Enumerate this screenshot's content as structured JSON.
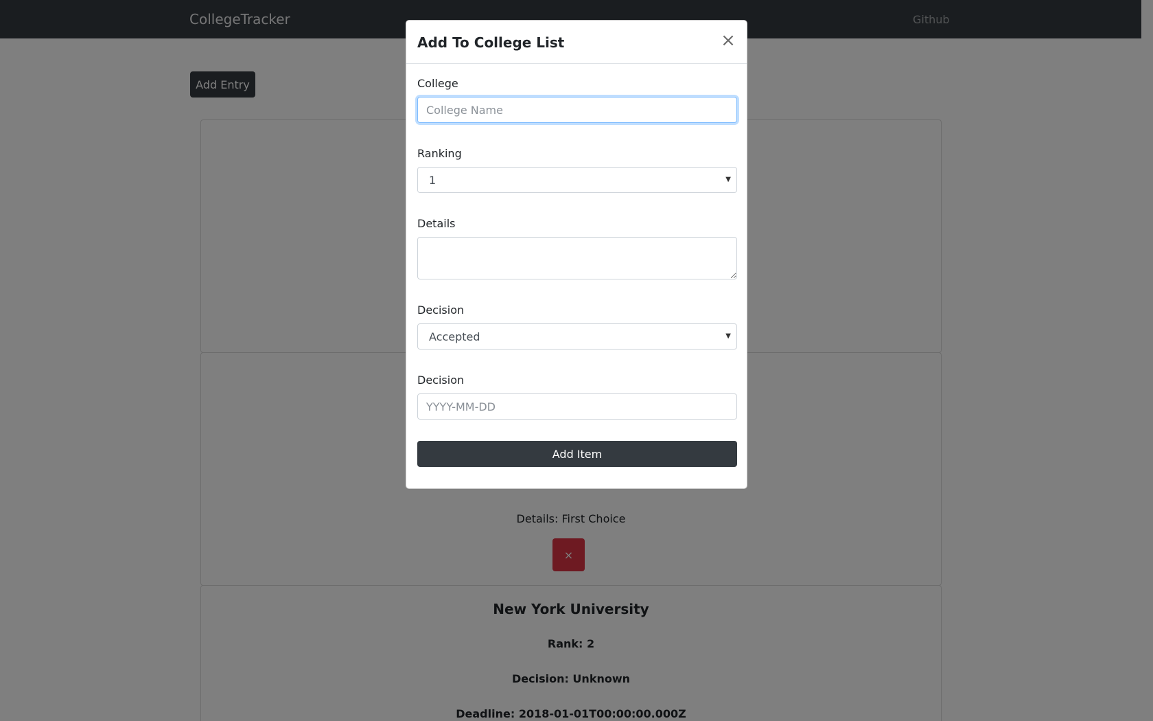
{
  "navbar": {
    "brand": "CollegeTracker",
    "link": "Github"
  },
  "main": {
    "add_entry_label": "Add Entry",
    "cards": [
      {
        "details": "Details: First Choice",
        "delete_label": "×"
      },
      {
        "title": "New York University",
        "rank": "Rank: 2",
        "decision": "Decision: Unknown",
        "deadline": "Deadline: 2018-01-01T00:00:00.000Z"
      }
    ]
  },
  "modal": {
    "title": "Add To College List",
    "close_label": "×",
    "college_label": "College",
    "college_placeholder": "College Name",
    "ranking_label": "Ranking",
    "ranking_value": "1",
    "details_label": "Details",
    "decision_label": "Decision",
    "decision_value": "Accepted",
    "deadline_label": "Decision",
    "deadline_placeholder": "YYYY-MM-DD",
    "submit_label": "Add Item"
  },
  "colors": {
    "navbar": "#343a40",
    "danger": "#dc3545",
    "focus": "#80bdff"
  }
}
